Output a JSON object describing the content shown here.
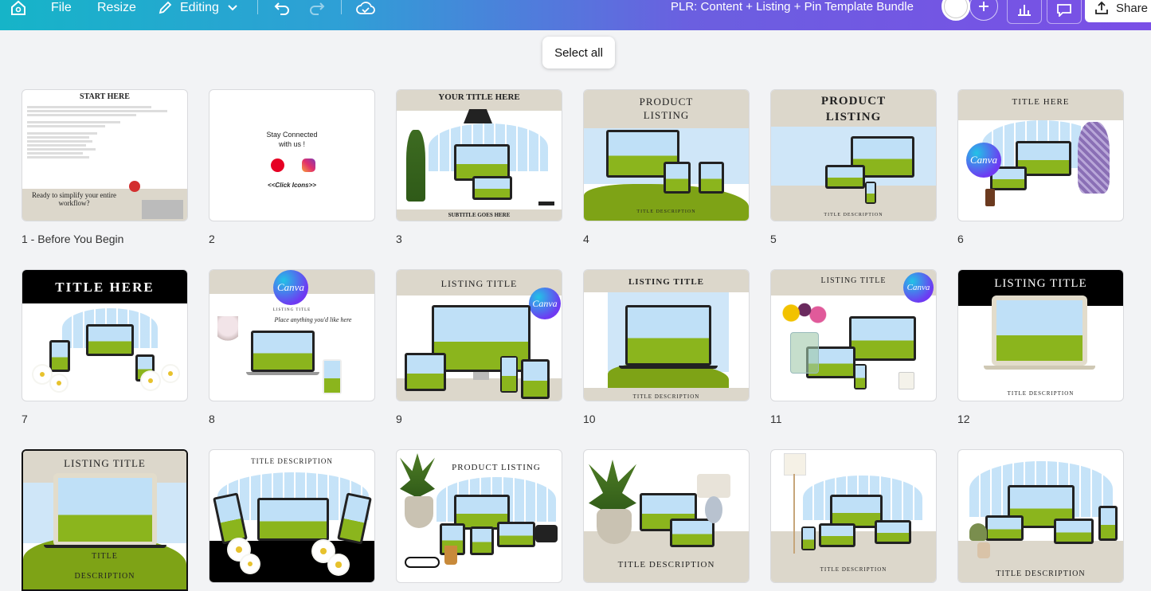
{
  "toolbar": {
    "file": "File",
    "resize": "Resize",
    "editing": "Editing",
    "doc_title": "PLR: Content + Listing + Pin Template Bundle",
    "share": "Share"
  },
  "select_all": "Select all",
  "pages": [
    {
      "caption": "1 - Before You Begin",
      "heading": "START HERE",
      "cta": "Ready to simplify your entire workflow?"
    },
    {
      "caption": "2",
      "line1": "Stay Connected",
      "line2": "with us !",
      "link": "<<Click Icons>>"
    },
    {
      "caption": "3",
      "heading": "YOUR TITLE HERE",
      "sub": "SUBTITLE GOES HERE"
    },
    {
      "caption": "4",
      "heading1": "PRODUCT",
      "heading2": "LISTING",
      "sub": "TITLE DESCRIPTION"
    },
    {
      "caption": "5",
      "heading1": "PRODUCT",
      "heading2": "LISTING",
      "sub": "TITLE DESCRIPTION"
    },
    {
      "caption": "6",
      "heading": "TITLE HERE",
      "logo": "Canva"
    },
    {
      "caption": "7",
      "heading": "TITLE HERE"
    },
    {
      "caption": "8",
      "logo": "Canva",
      "small": "LISTING TITLE",
      "script": "Place anything you'd like here"
    },
    {
      "caption": "9",
      "heading": "LISTING TITLE",
      "logo": "Canva"
    },
    {
      "caption": "10",
      "heading": "LISTING TITLE",
      "sub": "TITLE DESCRIPTION"
    },
    {
      "caption": "11",
      "heading": "LISTING TITLE",
      "logo": "Canva"
    },
    {
      "caption": "12",
      "heading": "LISTING TITLE",
      "sub": "TITLE DESCRIPTION"
    },
    {
      "caption": "",
      "heading": "LISTING TITLE",
      "sub1": "TITLE",
      "sub2": "DESCRIPTION"
    },
    {
      "caption": "",
      "heading": "TITLE DESCRIPTION"
    },
    {
      "caption": "",
      "heading": "PRODUCT LISTING"
    },
    {
      "caption": "",
      "sub": "TITLE DESCRIPTION"
    },
    {
      "caption": "",
      "sub": "TITLE DESCRIPTION"
    },
    {
      "caption": "",
      "sub": "TITLE DESCRIPTION"
    }
  ]
}
